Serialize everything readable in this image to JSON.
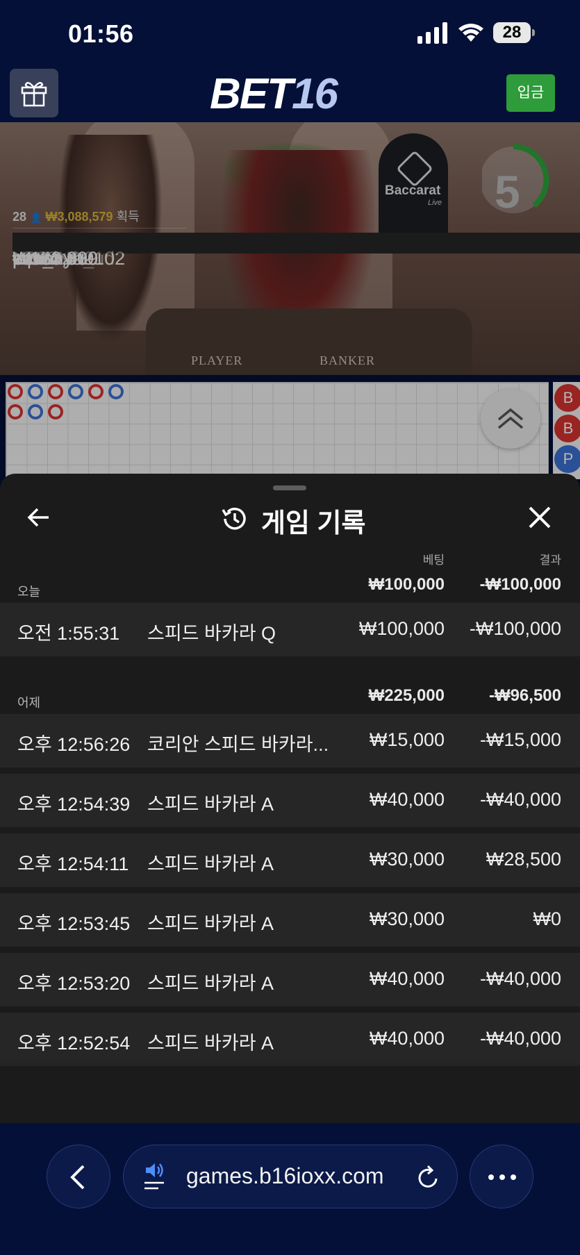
{
  "status_bar": {
    "time": "01:56",
    "battery": "28"
  },
  "header": {
    "logo_bet": "BET",
    "logo_num": "16",
    "deposit_label": "입금"
  },
  "video": {
    "winners_count": "28",
    "winners_total": "₩3,088,579",
    "winners_suffix": "획득",
    "winners": [
      {
        "amount": "₩763,420",
        "name": "pipi"
      },
      {
        "amount": "₩381,710",
        "name": "paaa"
      },
      {
        "amount": "₩312,000",
        "name": "11171292"
      },
      {
        "amount": "₩170,000",
        "name": "ww24"
      },
      {
        "amount": "₩160,309",
        "name": "kann"
      },
      {
        "amount": "₩150,000",
        "name": "c01_hyh0102"
      },
      {
        "amount": "₩140,000",
        "name": "N380NA_ud"
      }
    ],
    "timer": "5",
    "sign_text": "Baccarat",
    "sign_live": "Live",
    "table_player": "PLAYER",
    "table_banker": "BANKER"
  },
  "side_labels": [
    "B",
    "B",
    "P"
  ],
  "sheet": {
    "title": "게임 기록",
    "col_bet": "베팅",
    "col_result": "결과",
    "groups": [
      {
        "label": "오늘",
        "bet": "₩100,000",
        "result": "-₩100,000",
        "rows": [
          {
            "time": "오전 1:55:31",
            "game": "스피드 바카라 Q",
            "bet": "₩100,000",
            "result": "-₩100,000"
          }
        ]
      },
      {
        "label": "어제",
        "bet": "₩225,000",
        "result": "-₩96,500",
        "rows": [
          {
            "time": "오후 12:56:26",
            "game": "코리안 스피드 바카라...",
            "bet": "₩15,000",
            "result": "-₩15,000"
          },
          {
            "time": "오후 12:54:39",
            "game": "스피드 바카라 A",
            "bet": "₩40,000",
            "result": "-₩40,000"
          },
          {
            "time": "오후 12:54:11",
            "game": "스피드 바카라 A",
            "bet": "₩30,000",
            "result": "₩28,500"
          },
          {
            "time": "오후 12:53:45",
            "game": "스피드 바카라 A",
            "bet": "₩30,000",
            "result": "₩0"
          },
          {
            "time": "오후 12:53:20",
            "game": "스피드 바카라 A",
            "bet": "₩40,000",
            "result": "-₩40,000"
          },
          {
            "time": "오후 12:52:54",
            "game": "스피드 바카라 A",
            "bet": "₩40,000",
            "result": "-₩40,000"
          }
        ]
      }
    ]
  },
  "browser": {
    "url": "games.b16ioxx.com"
  }
}
